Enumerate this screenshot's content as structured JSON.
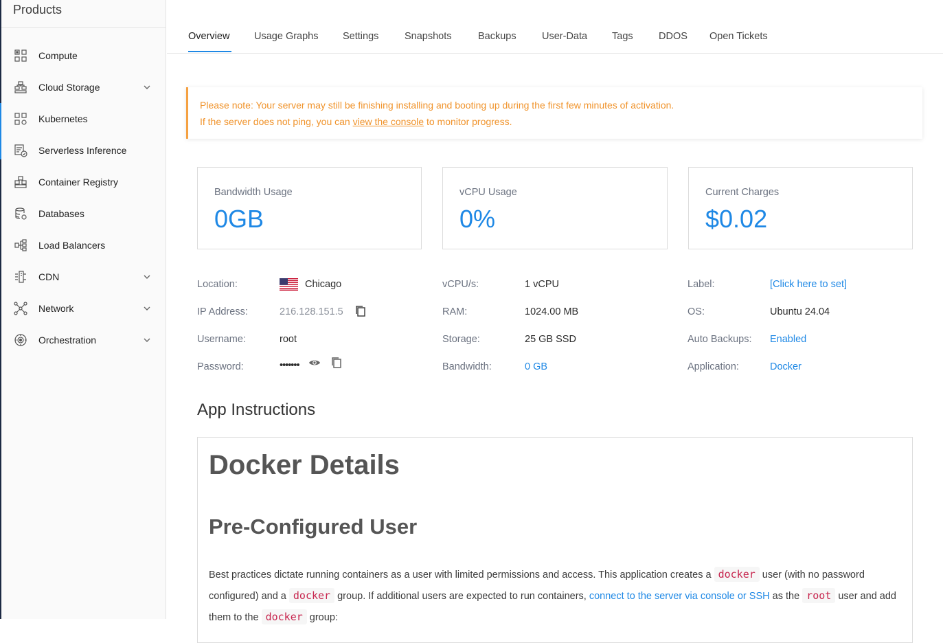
{
  "sidebar": {
    "title": "Products",
    "items": [
      {
        "label": "Compute",
        "icon": "compute-icon",
        "has_chevron": false
      },
      {
        "label": "Cloud Storage",
        "icon": "cloud-storage-icon",
        "has_chevron": true
      },
      {
        "label": "Kubernetes",
        "icon": "kubernetes-icon",
        "has_chevron": false
      },
      {
        "label": "Serverless Inference",
        "icon": "serverless-icon",
        "has_chevron": false
      },
      {
        "label": "Container Registry",
        "icon": "container-registry-icon",
        "has_chevron": false
      },
      {
        "label": "Databases",
        "icon": "database-icon",
        "has_chevron": false
      },
      {
        "label": "Load Balancers",
        "icon": "load-balancer-icon",
        "has_chevron": false
      },
      {
        "label": "CDN",
        "icon": "cdn-icon",
        "has_chevron": true
      },
      {
        "label": "Network",
        "icon": "network-icon",
        "has_chevron": true
      },
      {
        "label": "Orchestration",
        "icon": "orchestration-icon",
        "has_chevron": true
      }
    ]
  },
  "tabs": [
    {
      "label": "Overview",
      "active": true
    },
    {
      "label": "Usage Graphs"
    },
    {
      "label": "Settings"
    },
    {
      "label": "Snapshots"
    },
    {
      "label": "Backups"
    },
    {
      "label": "User-Data"
    },
    {
      "label": "Tags"
    },
    {
      "label": "DDOS"
    },
    {
      "label": "Open Tickets"
    }
  ],
  "notice": {
    "line1": "Please note: Your server may still be finishing installing and booting up during the first few minutes of activation.",
    "line2_before": "If the server does not ping, you can ",
    "line2_link": "view the console",
    "line2_after": " to monitor progress."
  },
  "cards": [
    {
      "title": "Bandwidth Usage",
      "value": "0GB"
    },
    {
      "title": "vCPU Usage",
      "value": "0%"
    },
    {
      "title": "Current Charges",
      "value": "$0.02"
    }
  ],
  "details": {
    "location_label": "Location:",
    "location_value": "Chicago",
    "ip_label": "IP Address:",
    "ip_value": "216.128.151.5",
    "username_label": "Username:",
    "username_value": "root",
    "password_label": "Password:",
    "password_value": "•••••••",
    "vcpu_label": "vCPU/s:",
    "vcpu_value": "1 vCPU",
    "ram_label": "RAM:",
    "ram_value": "1024.00 MB",
    "storage_label": "Storage:",
    "storage_value": "25 GB SSD",
    "bandwidth_label": "Bandwidth:",
    "bandwidth_value": "0 GB",
    "label_label": "Label:",
    "label_value": "[Click here to set]",
    "os_label": "OS:",
    "os_value": "Ubuntu 24.04",
    "backups_label": "Auto Backups:",
    "backups_value": "Enabled",
    "application_label": "Application:",
    "application_value": "Docker"
  },
  "app": {
    "section_title": "App Instructions",
    "h1": "Docker Details",
    "h2": "Pre-Configured User",
    "p_1": "Best practices dictate running containers as a user with limited permissions and access. This application creates a ",
    "code_1": "docker",
    "p_2": " user (with no password configured) and a ",
    "code_2": "docker",
    "p_3": " group. If additional users are expected to run containers, ",
    "link": "connect to the server via console or SSH",
    "p_4": " as the ",
    "code_3": "root",
    "p_5": " user and add them to the ",
    "code_4": "docker",
    "p_6": " group:"
  },
  "colors": {
    "accent": "#1e88e5",
    "notice": "#f0932b",
    "sidebar_border": "#1d2a44"
  }
}
